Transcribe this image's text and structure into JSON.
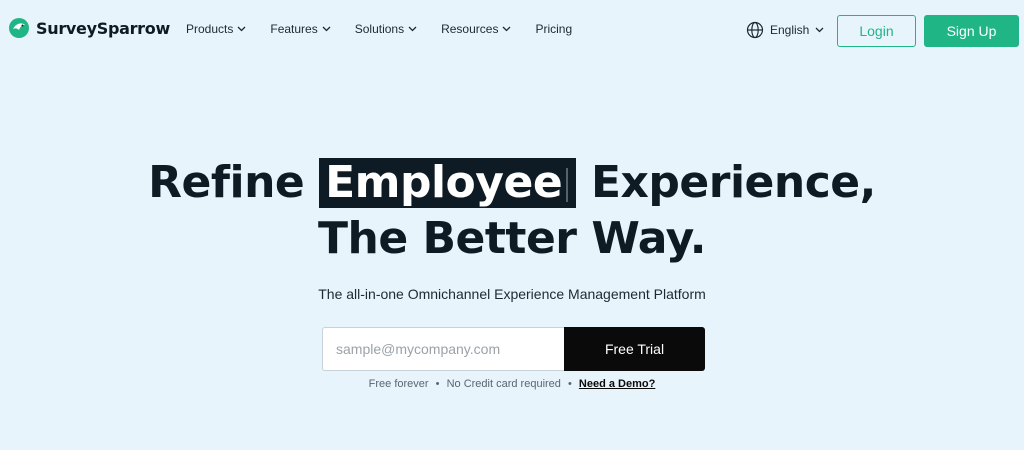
{
  "brand": {
    "name": "SurveySparrow",
    "accent": "#20b585",
    "dark": "#0f1b24"
  },
  "nav": {
    "items": [
      {
        "label": "Products",
        "icon": "chevron-down-icon"
      },
      {
        "label": "Features",
        "icon": "chevron-down-icon"
      },
      {
        "label": "Solutions",
        "icon": "chevron-down-icon"
      },
      {
        "label": "Resources",
        "icon": "chevron-down-icon"
      },
      {
        "label": "Pricing"
      }
    ],
    "language": {
      "label": "English",
      "icon": "globe-icon"
    },
    "login_label": "Login",
    "signup_label": "Sign Up"
  },
  "hero": {
    "headline_prefix": "Refine",
    "headline_highlight": "Employee",
    "headline_suffix": "Experience,",
    "headline_line2": "The Better Way.",
    "subtitle": "The all-in-one Omnichannel Experience Management Platform",
    "email_placeholder": "sample@mycompany.com",
    "cta_label": "Free Trial",
    "note_part1": "Free forever",
    "note_part2": "No Credit card required",
    "separator": "•",
    "demo_link": "Need a Demo?"
  }
}
